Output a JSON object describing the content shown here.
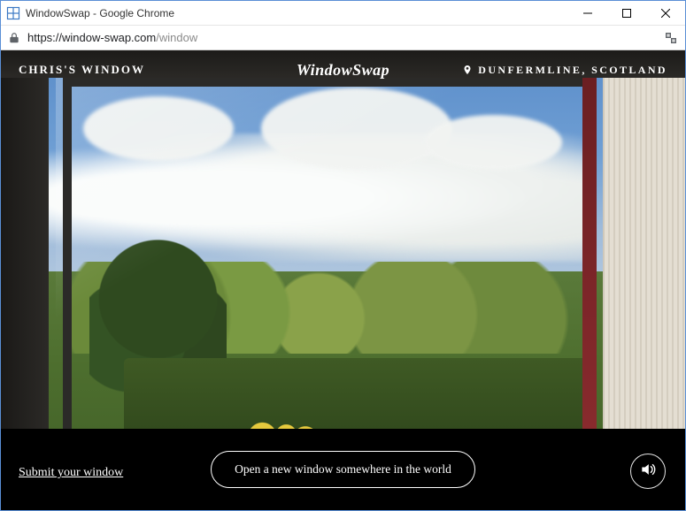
{
  "window": {
    "title": "WindowSwap - Google Chrome"
  },
  "address": {
    "url_host": "https://window-swap.com",
    "url_path": "/window"
  },
  "overlay": {
    "owner": "CHRIS'S WINDOW",
    "brand": "WindowSwap",
    "location": "DUNFERMLINE, SCOTLAND"
  },
  "footer": {
    "submit": "Submit your window",
    "open_button": "Open a new window somewhere in the world"
  }
}
